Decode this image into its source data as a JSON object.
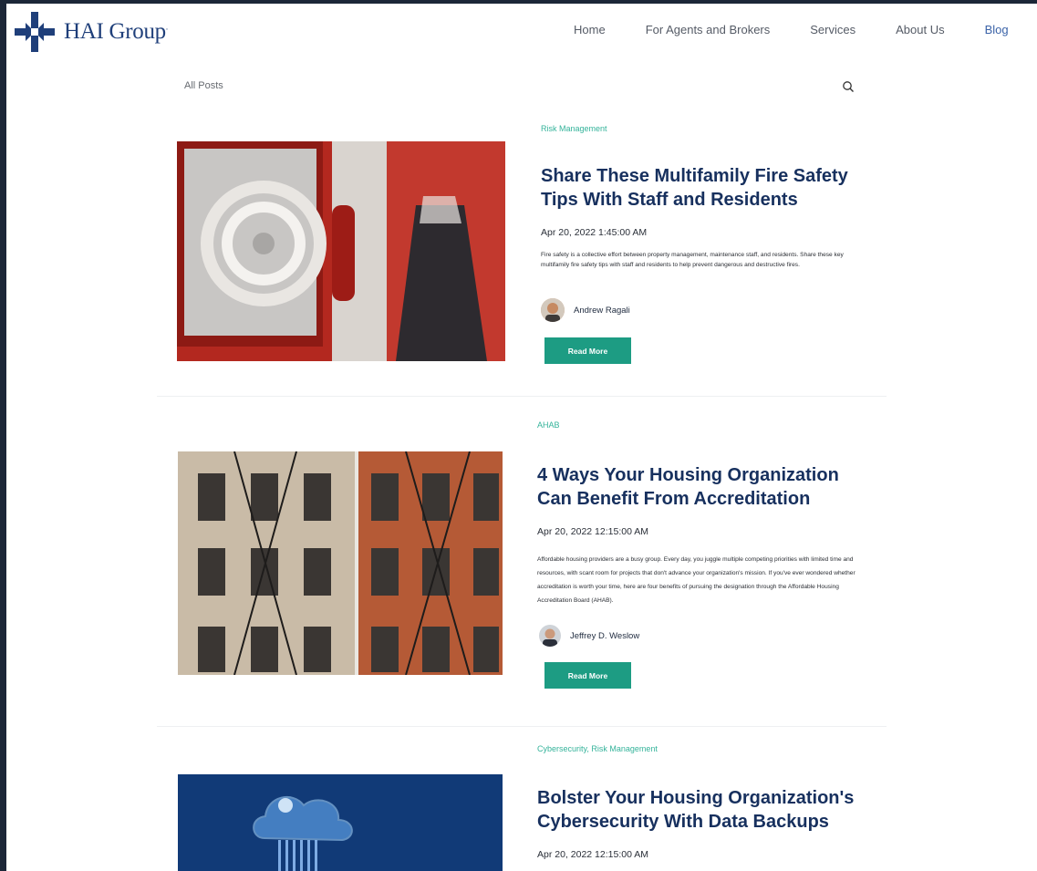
{
  "brand": {
    "name": "HAI Group",
    "mark": "."
  },
  "nav": {
    "items": [
      {
        "label": "Home"
      },
      {
        "label": "For Agents and Brokers"
      },
      {
        "label": "Services"
      },
      {
        "label": "About Us"
      },
      {
        "label": "Blog"
      }
    ]
  },
  "subbar": {
    "all_posts_label": "All Posts",
    "search_icon": "search-icon"
  },
  "posts": [
    {
      "category": "Risk Management",
      "title": "Share These Multifamily Fire Safety Tips With Staff and Residents",
      "date": "Apr 20, 2022 1:45:00 AM",
      "excerpt": "Fire safety is a collective effort between property management, maintenance staff, and residents. Share these key multifamily fire safety tips with staff and residents to help prevent dangerous and destructive fires.",
      "author": "Andrew Ragali",
      "read_more": "Read More"
    },
    {
      "category": "AHAB",
      "title": "4 Ways Your Housing Organization Can Benefit From Accreditation",
      "date": "Apr 20, 2022 12:15:00 AM",
      "excerpt": "Affordable housing providers are a busy group. Every day, you juggle multiple competing priorities with limited time and resources, with scant room for projects that don't advance your organization's mission. If you've ever wondered whether accreditation is worth your time, here are four benefits of pursuing the designation through the Affordable Housing Accreditation Board (AHAB).",
      "author": "Jeffrey D. Weslow",
      "read_more": "Read More"
    },
    {
      "category": "Cybersecurity, Risk Management",
      "title": "Bolster Your Housing Organization's Cybersecurity With Data Backups",
      "date": "Apr 20, 2022 12:15:00 AM"
    }
  ],
  "colors": {
    "accent": "#1d9c83",
    "category": "#34b39a",
    "title": "#17305e",
    "nav_active": "#3b63a8",
    "frame": "#1c2738"
  }
}
